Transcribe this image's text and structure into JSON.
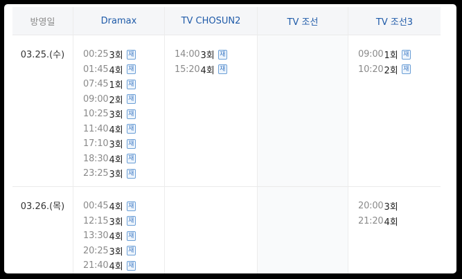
{
  "header": {
    "date_col": "방영일",
    "channels": [
      "Dramax",
      "TV CHOSUN2",
      "TV 조선",
      "TV 조선3"
    ]
  },
  "rerun_badge": "재",
  "rows": [
    {
      "date": "03.25.(수)",
      "channels": [
        [
          {
            "time": "00:25",
            "ep": "3회",
            "rerun": true
          },
          {
            "time": "01:45",
            "ep": "4회",
            "rerun": true
          },
          {
            "time": "07:45",
            "ep": "1회",
            "rerun": true
          },
          {
            "time": "09:00",
            "ep": "2회",
            "rerun": true
          },
          {
            "time": "10:25",
            "ep": "3회",
            "rerun": true
          },
          {
            "time": "11:40",
            "ep": "4회",
            "rerun": true
          },
          {
            "time": "17:10",
            "ep": "3회",
            "rerun": true
          },
          {
            "time": "18:30",
            "ep": "4회",
            "rerun": true
          },
          {
            "time": "23:25",
            "ep": "3회",
            "rerun": true
          }
        ],
        [
          {
            "time": "14:00",
            "ep": "3회",
            "rerun": true
          },
          {
            "time": "15:20",
            "ep": "4회",
            "rerun": true
          }
        ],
        [],
        [
          {
            "time": "09:00",
            "ep": "1회",
            "rerun": true
          },
          {
            "time": "10:20",
            "ep": "2회",
            "rerun": true
          }
        ]
      ]
    },
    {
      "date": "03.26.(목)",
      "channels": [
        [
          {
            "time": "00:45",
            "ep": "4회",
            "rerun": true
          },
          {
            "time": "12:15",
            "ep": "3회",
            "rerun": true
          },
          {
            "time": "13:30",
            "ep": "4회",
            "rerun": true
          },
          {
            "time": "20:25",
            "ep": "3회",
            "rerun": true
          },
          {
            "time": "21:40",
            "ep": "4회",
            "rerun": true
          }
        ],
        [],
        [],
        [
          {
            "time": "20:00",
            "ep": "3회",
            "rerun": false
          },
          {
            "time": "21:20",
            "ep": "4회",
            "rerun": false
          }
        ]
      ]
    }
  ]
}
